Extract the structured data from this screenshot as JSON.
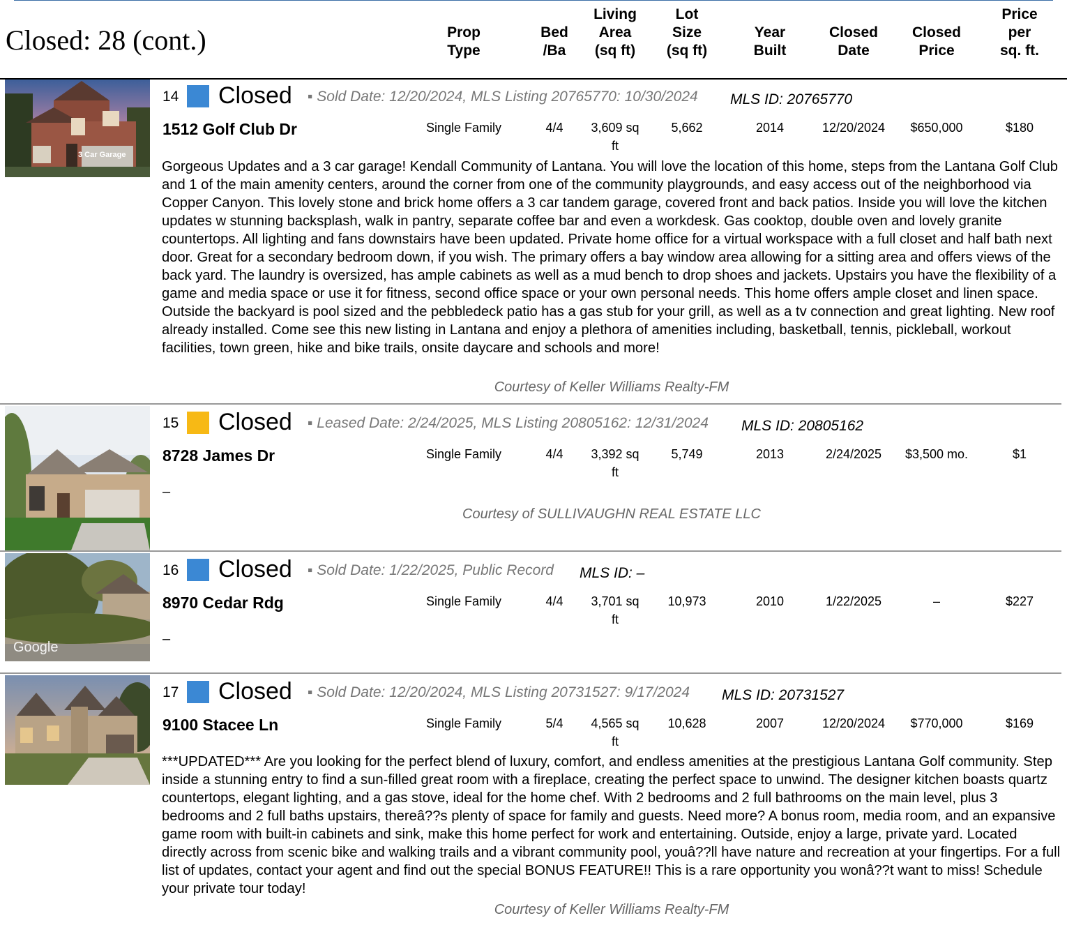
{
  "page": {
    "title": "Closed: 28 (cont.)"
  },
  "columns": {
    "prop_type": "Prop\nType",
    "bed_ba": "Bed\n/Ba",
    "living_area": "Living\nArea\n(sq ft)",
    "lot_size": "Lot\nSize\n(sq ft)",
    "year_built": "Year\nBuilt",
    "closed_date": "Closed\nDate",
    "closed_price": "Closed\nPrice",
    "price_per_sqft": "Price\nper\nsq. ft."
  },
  "colors": {
    "sold": "#3b88d4",
    "leased": "#f7b915"
  },
  "listings": [
    {
      "number": "14",
      "status": "Closed",
      "status_color": "#3b88d4",
      "dates": "▪ Sold Date: 12/20/2024, MLS Listing 20765770: 10/30/2024",
      "mls_id": "MLS ID: 20765770",
      "address": "1512 Golf Club Dr",
      "prop_type": "Single Family",
      "bed_ba": "4/4",
      "living_area": "3,609 sq ft",
      "lot_size": "5,662",
      "year_built": "2014",
      "closed_date": "12/20/2024",
      "closed_price": "$650,000",
      "price_per_sqft": "$180",
      "photo_caption": "3 Car Garage",
      "description": "Gorgeous Updates and a 3 car garage! Kendall Community of Lantana. You will love the location of this home, steps from the Lantana Golf Club and 1 of the main amenity centers, around the corner from one of the community playgrounds, and easy access out of the neighborhood via Copper Canyon. This lovely stone and brick home offers a 3 car tandem garage, covered front and back patios. Inside you will love the kitchen updates w stunning backsplash, walk in pantry, separate coffee bar and even a workdesk. Gas cooktop, double oven and lovely granite countertops. All lighting and fans downstairs have been updated. Private home office for a virtual workspace with a full closet and half bath next door. Great for a secondary bedroom down, if you wish. The primary offers a bay window area allowing for a sitting area and offers views of the back yard. The laundry is oversized, has ample cabinets as well as a mud bench to drop shoes and jackets. Upstairs you have the flexibility of a game and media space or use it for fitness, second office space or your own personal needs. This home offers ample closet and linen space. Outside the backyard is pool sized and the pebbledeck patio has a gas stub for your grill, as well as a tv connection and great lighting. New roof already installed. Come see this new listing in Lantana and enjoy a plethora of amenities including, basketball, tennis, pickleball, workout facilities, town green, hike and bike trails, onsite daycare and schools and more!",
      "courtesy": "Courtesy of Keller Williams Realty-FM"
    },
    {
      "number": "15",
      "status": "Closed",
      "status_color": "#f7b915",
      "dates": "▪ Leased Date: 2/24/2025, MLS Listing 20805162: 12/31/2024",
      "mls_id": "MLS ID: 20805162",
      "address": "8728 James Dr",
      "prop_type": "Single Family",
      "bed_ba": "4/4",
      "living_area": "3,392 sq ft",
      "lot_size": "5,749",
      "year_built": "2013",
      "closed_date": "2/24/2025",
      "closed_price": "$3,500 mo.",
      "price_per_sqft": "$1",
      "description": "–",
      "courtesy": "Courtesy of SULLIVAUGHN REAL ESTATE LLC"
    },
    {
      "number": "16",
      "status": "Closed",
      "status_color": "#3b88d4",
      "dates": "▪ Sold Date: 1/22/2025, Public Record",
      "mls_id": "MLS ID: –",
      "address": "8970 Cedar Rdg",
      "prop_type": "Single Family",
      "bed_ba": "4/4",
      "living_area": "3,701 sq ft",
      "lot_size": "10,973",
      "year_built": "2010",
      "closed_date": "1/22/2025",
      "closed_price": "–",
      "price_per_sqft": "$227",
      "photo_caption": "Google",
      "description": "–"
    },
    {
      "number": "17",
      "status": "Closed",
      "status_color": "#3b88d4",
      "dates": "▪ Sold Date: 12/20/2024, MLS Listing 20731527: 9/17/2024",
      "mls_id": "MLS ID: 20731527",
      "address": "9100 Stacee Ln",
      "prop_type": "Single Family",
      "bed_ba": "5/4",
      "living_area": "4,565 sq ft",
      "lot_size": "10,628",
      "year_built": "2007",
      "closed_date": "12/20/2024",
      "closed_price": "$770,000",
      "price_per_sqft": "$169",
      "description": "***UPDATED*** Are you looking for the perfect blend of luxury, comfort, and endless amenities at the prestigious Lantana Golf community. Step inside a stunning entry to find a sun-filled great room with a fireplace, creating the perfect space to unwind. The designer kitchen boasts quartz countertops, elegant lighting, and a gas stove, ideal for the home chef. With 2 bedrooms and 2 full bathrooms on the main level, plus 3 bedrooms and 2 full baths upstairs, thereâ??s plenty of space for family and guests. Need more? A bonus room, media room, and an expansive game room with built-in cabinets and sink, make this home perfect for work and entertaining. Outside, enjoy a large, private yard. Located directly across from scenic bike and walking trails and a vibrant community pool, youâ??ll have nature and recreation at your fingertips. For a full list of updates, contact your agent and find out the special BONUS FEATURE!! This is a rare opportunity you wonâ??t want to miss! Schedule your private tour today!",
      "courtesy": "Courtesy of Keller Williams Realty-FM"
    }
  ]
}
